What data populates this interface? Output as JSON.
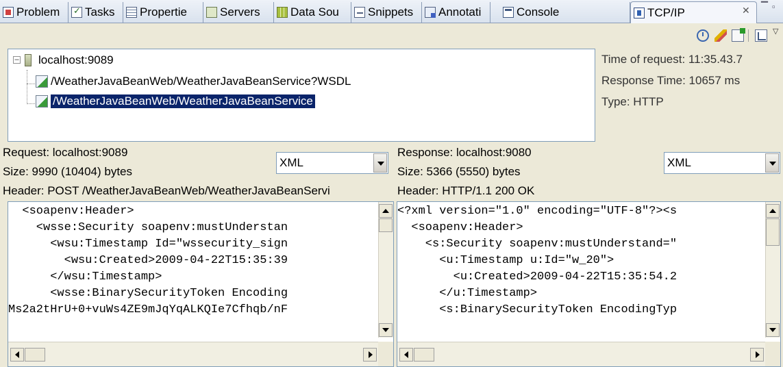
{
  "tabs": [
    {
      "label": "Problem",
      "icon": "problems-icon"
    },
    {
      "label": "Tasks",
      "icon": "tasks-icon"
    },
    {
      "label": "Propertie",
      "icon": "properties-icon"
    },
    {
      "label": "Servers",
      "icon": "servers-icon"
    },
    {
      "label": "Data Sou",
      "icon": "data-source-icon"
    },
    {
      "label": "Snippets",
      "icon": "snippets-icon"
    },
    {
      "label": "Annotati",
      "icon": "annotations-icon"
    },
    {
      "label": "Console",
      "icon": "console-icon"
    },
    {
      "label": "TCP/IP",
      "icon": "tcpip-monitor-icon",
      "active": true
    }
  ],
  "tree": {
    "host": "localhost:9089",
    "items": [
      {
        "label": "/WeatherJavaBeanWeb/WeatherJavaBeanService?WSDL",
        "selected": false
      },
      {
        "label": "/WeatherJavaBeanWeb/WeatherJavaBeanService",
        "selected": true
      }
    ]
  },
  "info": {
    "time_of_request": "Time of request: 11:35.43.7",
    "response_time": "Response Time: 10657 ms",
    "type": "Type: HTTP"
  },
  "request": {
    "title": "Request: localhost:9089",
    "size": "Size: 9990 (10404) bytes",
    "header": "Header: POST /WeatherJavaBeanWeb/WeatherJavaBeanServi",
    "format": "XML",
    "lines": [
      "  <soapenv:Header>",
      "    <wsse:Security soapenv:mustUnderstan",
      "      <wsu:Timestamp Id=\"wssecurity_sign",
      "        <wsu:Created>2009-04-22T15:35:39",
      "      </wsu:Timestamp>",
      "      <wsse:BinarySecurityToken Encoding",
      "Ms2a2tHrU+0+vuWs4ZE9mJqYqALKQIe7Cfhqb/nF"
    ]
  },
  "response": {
    "title": "Response: localhost:9080",
    "size": "Size: 5366 (5550) bytes",
    "header": "Header: HTTP/1.1 200 OK",
    "format": "XML",
    "lines": [
      "<?xml version=\"1.0\" encoding=\"UTF-8\"?><s",
      "  <soapenv:Header>",
      "    <s:Security soapenv:mustUnderstand=\"",
      "      <u:Timestamp u:Id=\"w_20\">",
      "        <u:Created>2009-04-22T15:35:54.2",
      "      </u:Timestamp>",
      "      <s:BinarySecurityToken EncodingTyp"
    ]
  }
}
